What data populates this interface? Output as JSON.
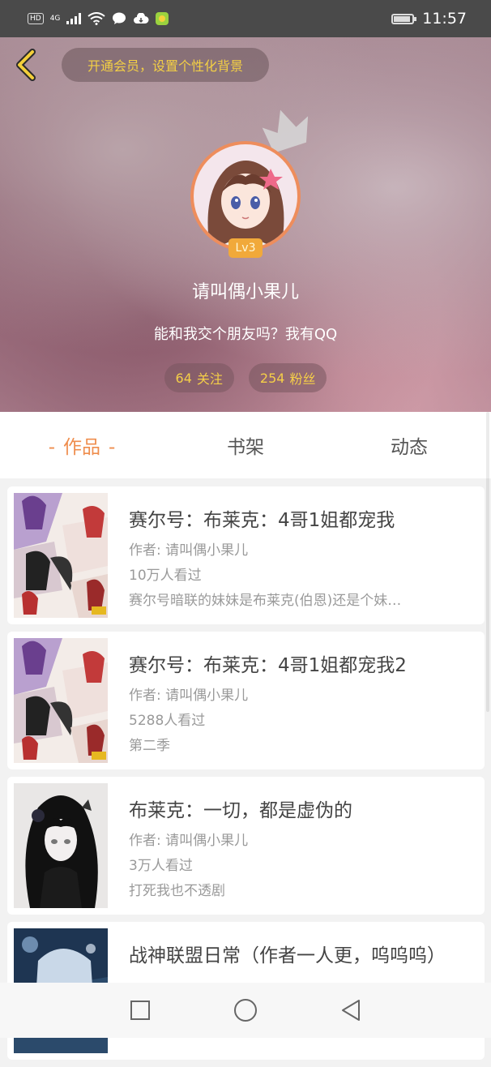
{
  "status_bar": {
    "hd": "HD",
    "network": "4G",
    "time": "11:57"
  },
  "header": {
    "vip_banner": "开通会员，设置个性化背景",
    "level": "Lv3",
    "nickname": "请叫偶小果儿",
    "bio": "能和我交个朋友吗？我有QQ",
    "following": {
      "count": "64",
      "label": "关注"
    },
    "fans": {
      "count": "254",
      "label": "粉丝"
    }
  },
  "tabs": {
    "works": "作品",
    "works_dash": "-",
    "bookshelf": "书架",
    "activity": "动态"
  },
  "works": [
    {
      "title": "赛尔号：布莱克：4哥1姐都宠我",
      "author": "作者: 请叫偶小果儿",
      "views": "10万人看过",
      "desc": "赛尔号暗联的妹妹是布莱克(伯恩)还是个妹…"
    },
    {
      "title": "赛尔号：布莱克：4哥1姐都宠我2",
      "author": "作者: 请叫偶小果儿",
      "views": "5288人看过",
      "desc": "第二季"
    },
    {
      "title": "布莱克：一切，都是虚伪的",
      "author": "作者: 请叫偶小果儿",
      "views": "3万人看过",
      "desc": "打死我也不透剧"
    },
    {
      "title": "战神联盟日常（作者一人更，呜呜呜）",
      "author": "",
      "views": "",
      "desc": ""
    }
  ],
  "colors": {
    "accent": "#ef8d4d",
    "gold": "#f5cf48",
    "badge": "#f1a93a"
  }
}
